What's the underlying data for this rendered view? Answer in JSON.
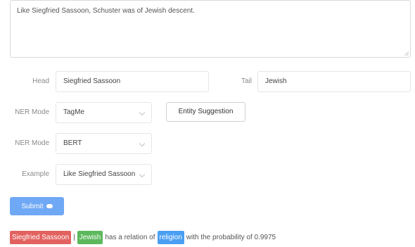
{
  "sentence": "Like Siegfried Sassoon, Schuster was of Jewish descent.",
  "head": {
    "label": "Head",
    "value": "Siegfried Sassoon"
  },
  "tail": {
    "label": "Tail",
    "value": "Jewish"
  },
  "ner_mode_1": {
    "label": "NER Mode",
    "value": "TagMe"
  },
  "entity_suggestion_label": "Entity Suggestion",
  "ner_mode_2": {
    "label": "NER Mode",
    "value": "BERT"
  },
  "example": {
    "label": "Example",
    "value": "Like Siegfried Sassoon"
  },
  "submit_label": "Submit",
  "result": {
    "head": "Siegfried Sassoon",
    "separator": "|",
    "tail": "Jewish",
    "text1": "has a relation of",
    "relation": "religion",
    "text2": "with the probability of 0.9975"
  }
}
